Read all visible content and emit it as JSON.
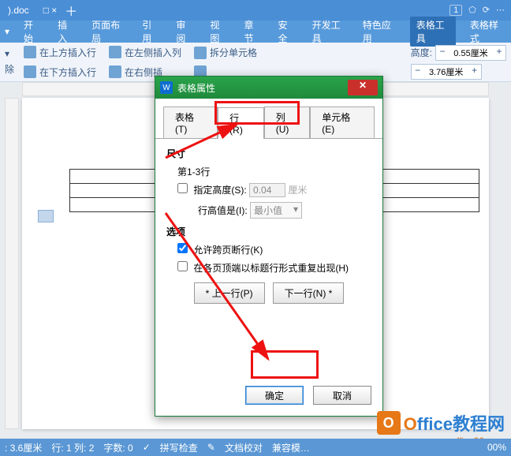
{
  "title": {
    "doc": ").doc",
    "tabicons": "□ ×",
    "indicator": "1"
  },
  "menu": {
    "items": [
      "开始",
      "插入",
      "页面布局",
      "引用",
      "审阅",
      "视图",
      "章节",
      "安全",
      "开发工具",
      "特色应用",
      "表格工具",
      "表格样式"
    ],
    "active_index": 10
  },
  "toolbar": {
    "insert_above": "在上方插入行",
    "insert_below": "在下方插入行",
    "insert_left": "在左侧插入列",
    "insert_right": "在右侧插",
    "split_cells": "拆分单元格",
    "height_label": "高度:",
    "height_value": "0.55厘米",
    "width_value": "3.76厘米",
    "delete": "除"
  },
  "dialog": {
    "title": "表格属性",
    "tabs": {
      "table": "表格(T)",
      "row": "行(R)",
      "column": "列(U)",
      "cell": "单元格(E)"
    },
    "size_section": "尺寸",
    "rows_range": "第1-3行",
    "specify_height": "指定高度(S):",
    "height_value": "0.04",
    "height_unit": "厘米",
    "row_height_is": "行高值是(I):",
    "row_height_mode": "最小值",
    "options_section": "选项",
    "allow_break": "允许跨页断行(K)",
    "repeat_header": "在各页顶端以标题行形式重复出现(H)",
    "prev_row": "* 上一行(P)",
    "next_row": "下一行(N) *",
    "ok": "确定",
    "cancel": "取消"
  },
  "status": {
    "pos": ": 3.6厘米",
    "rowcol": "行: 1  列: 2",
    "wordcount": "字数: 0",
    "spellcheck": "拼写检查",
    "proofread": "文档校对",
    "compat": "兼容模…",
    "zoom": "00%"
  },
  "watermark": {
    "brand_o": "O",
    "brand_rest": "ffice教程网",
    "url": "www.office26.com"
  }
}
